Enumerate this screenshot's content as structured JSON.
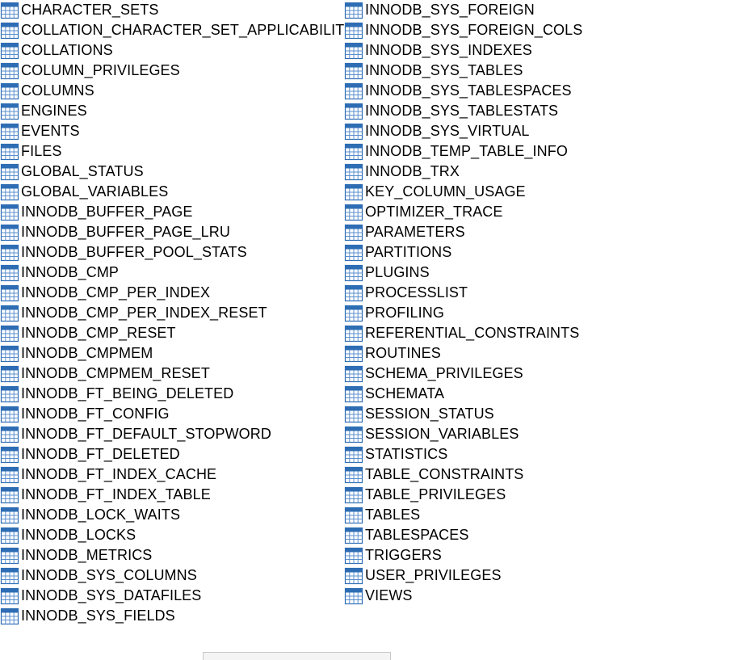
{
  "icon": "table-icon",
  "colors": {
    "icon_header": "#2e6db4",
    "icon_grid": "#5a8fcd",
    "icon_body": "#ffffff",
    "text": "#000000"
  },
  "tables": {
    "left": [
      "CHARACTER_SETS",
      "COLLATION_CHARACTER_SET_APPLICABILITY",
      "COLLATIONS",
      "COLUMN_PRIVILEGES",
      "COLUMNS",
      "ENGINES",
      "EVENTS",
      "FILES",
      "GLOBAL_STATUS",
      "GLOBAL_VARIABLES",
      "INNODB_BUFFER_PAGE",
      "INNODB_BUFFER_PAGE_LRU",
      "INNODB_BUFFER_POOL_STATS",
      "INNODB_CMP",
      "INNODB_CMP_PER_INDEX",
      "INNODB_CMP_PER_INDEX_RESET",
      "INNODB_CMP_RESET",
      "INNODB_CMPMEM",
      "INNODB_CMPMEM_RESET",
      "INNODB_FT_BEING_DELETED",
      "INNODB_FT_CONFIG",
      "INNODB_FT_DEFAULT_STOPWORD",
      "INNODB_FT_DELETED",
      "INNODB_FT_INDEX_CACHE",
      "INNODB_FT_INDEX_TABLE",
      "INNODB_LOCK_WAITS",
      "INNODB_LOCKS",
      "INNODB_METRICS",
      "INNODB_SYS_COLUMNS",
      "INNODB_SYS_DATAFILES",
      "INNODB_SYS_FIELDS"
    ],
    "right": [
      "INNODB_SYS_FOREIGN",
      "INNODB_SYS_FOREIGN_COLS",
      "INNODB_SYS_INDEXES",
      "INNODB_SYS_TABLES",
      "INNODB_SYS_TABLESPACES",
      "INNODB_SYS_TABLESTATS",
      "INNODB_SYS_VIRTUAL",
      "INNODB_TEMP_TABLE_INFO",
      "INNODB_TRX",
      "KEY_COLUMN_USAGE",
      "OPTIMIZER_TRACE",
      "PARAMETERS",
      "PARTITIONS",
      "PLUGINS",
      "PROCESSLIST",
      "PROFILING",
      "REFERENTIAL_CONSTRAINTS",
      "ROUTINES",
      "SCHEMA_PRIVILEGES",
      "SCHEMATA",
      "SESSION_STATUS",
      "SESSION_VARIABLES",
      "STATISTICS",
      "TABLE_CONSTRAINTS",
      "TABLE_PRIVILEGES",
      "TABLES",
      "TABLESPACES",
      "TRIGGERS",
      "USER_PRIVILEGES",
      "VIEWS"
    ]
  }
}
